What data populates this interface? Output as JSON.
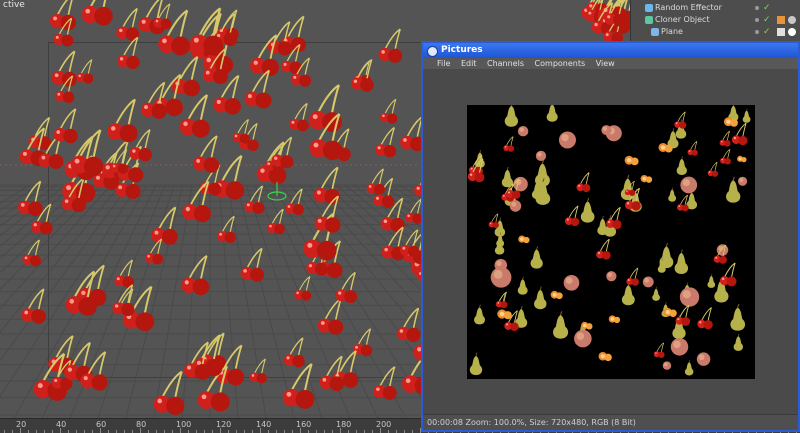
{
  "viewport": {
    "label": "ctive"
  },
  "timeline": {
    "ticks": [
      "20",
      "40",
      "60",
      "80",
      "100",
      "120",
      "140",
      "160",
      "180",
      "200"
    ]
  },
  "object_manager": {
    "rows": [
      {
        "label": "Random Effector"
      },
      {
        "label": "Cloner Object"
      },
      {
        "label": "Plane"
      }
    ]
  },
  "pictures_window": {
    "title": "Pictures",
    "menu": [
      "File",
      "Edit",
      "Channels",
      "Components",
      "View"
    ],
    "status": "00:00:08  Zoom: 100.0%, Size: 720x480, RGB (8 Bit)"
  },
  "colors": {
    "selection_border": "#2d5bd6",
    "titlebar": "#1f55d2",
    "cherry": "#d0201c",
    "pear": "#b8b24a",
    "viewport_bg": "#545454"
  }
}
